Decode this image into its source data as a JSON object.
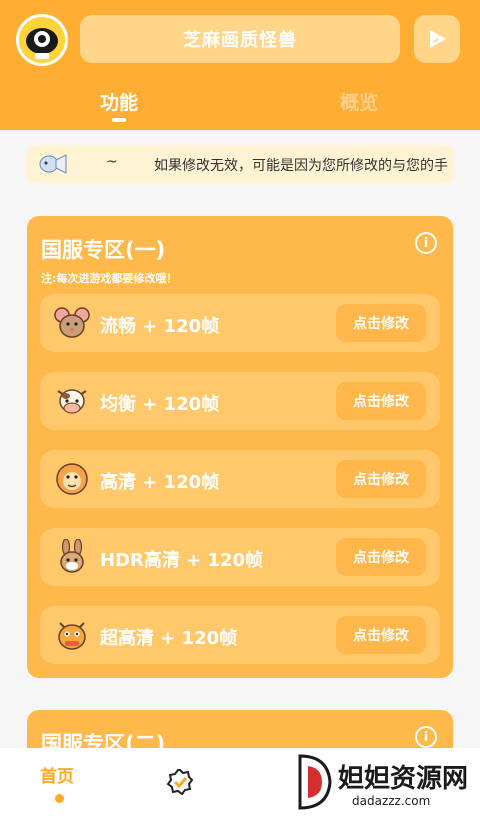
{
  "header": {
    "title": "芝麻画质怪兽",
    "tabs": [
      {
        "label": "功能",
        "active": true
      },
      {
        "label": "概览",
        "active": false
      }
    ]
  },
  "notice": {
    "tilde": "~",
    "text": "如果修改无效，可能是因为您所修改的与您的手"
  },
  "sections": [
    {
      "title": "国服专区(一)",
      "note": "注:每次进游戏都要修改哦！",
      "info_icon": "i",
      "rows": [
        {
          "icon": "mouse-icon",
          "label": "流畅 + 120帧",
          "button": "点击修改"
        },
        {
          "icon": "cow-icon",
          "label": "均衡 + 120帧",
          "button": "点击修改"
        },
        {
          "icon": "tiger-icon",
          "label": "高清 + 120帧",
          "button": "点击修改"
        },
        {
          "icon": "rabbit-icon",
          "label": "HDR高清 + 120帧",
          "button": "点击修改"
        },
        {
          "icon": "dragon-icon",
          "label": "超高清 + 120帧",
          "button": "点击修改"
        }
      ]
    },
    {
      "title": "国服专区(二)",
      "info_icon": "i"
    }
  ],
  "bottom_nav": {
    "home_label": "首页"
  },
  "watermark": {
    "text": "妲妲资源网",
    "sub": "dadazzz.com"
  },
  "colors": {
    "primary": "#ffae33",
    "section": "#ffb84a",
    "row": "#ffc96b",
    "notice_bg": "#fff3d4"
  }
}
